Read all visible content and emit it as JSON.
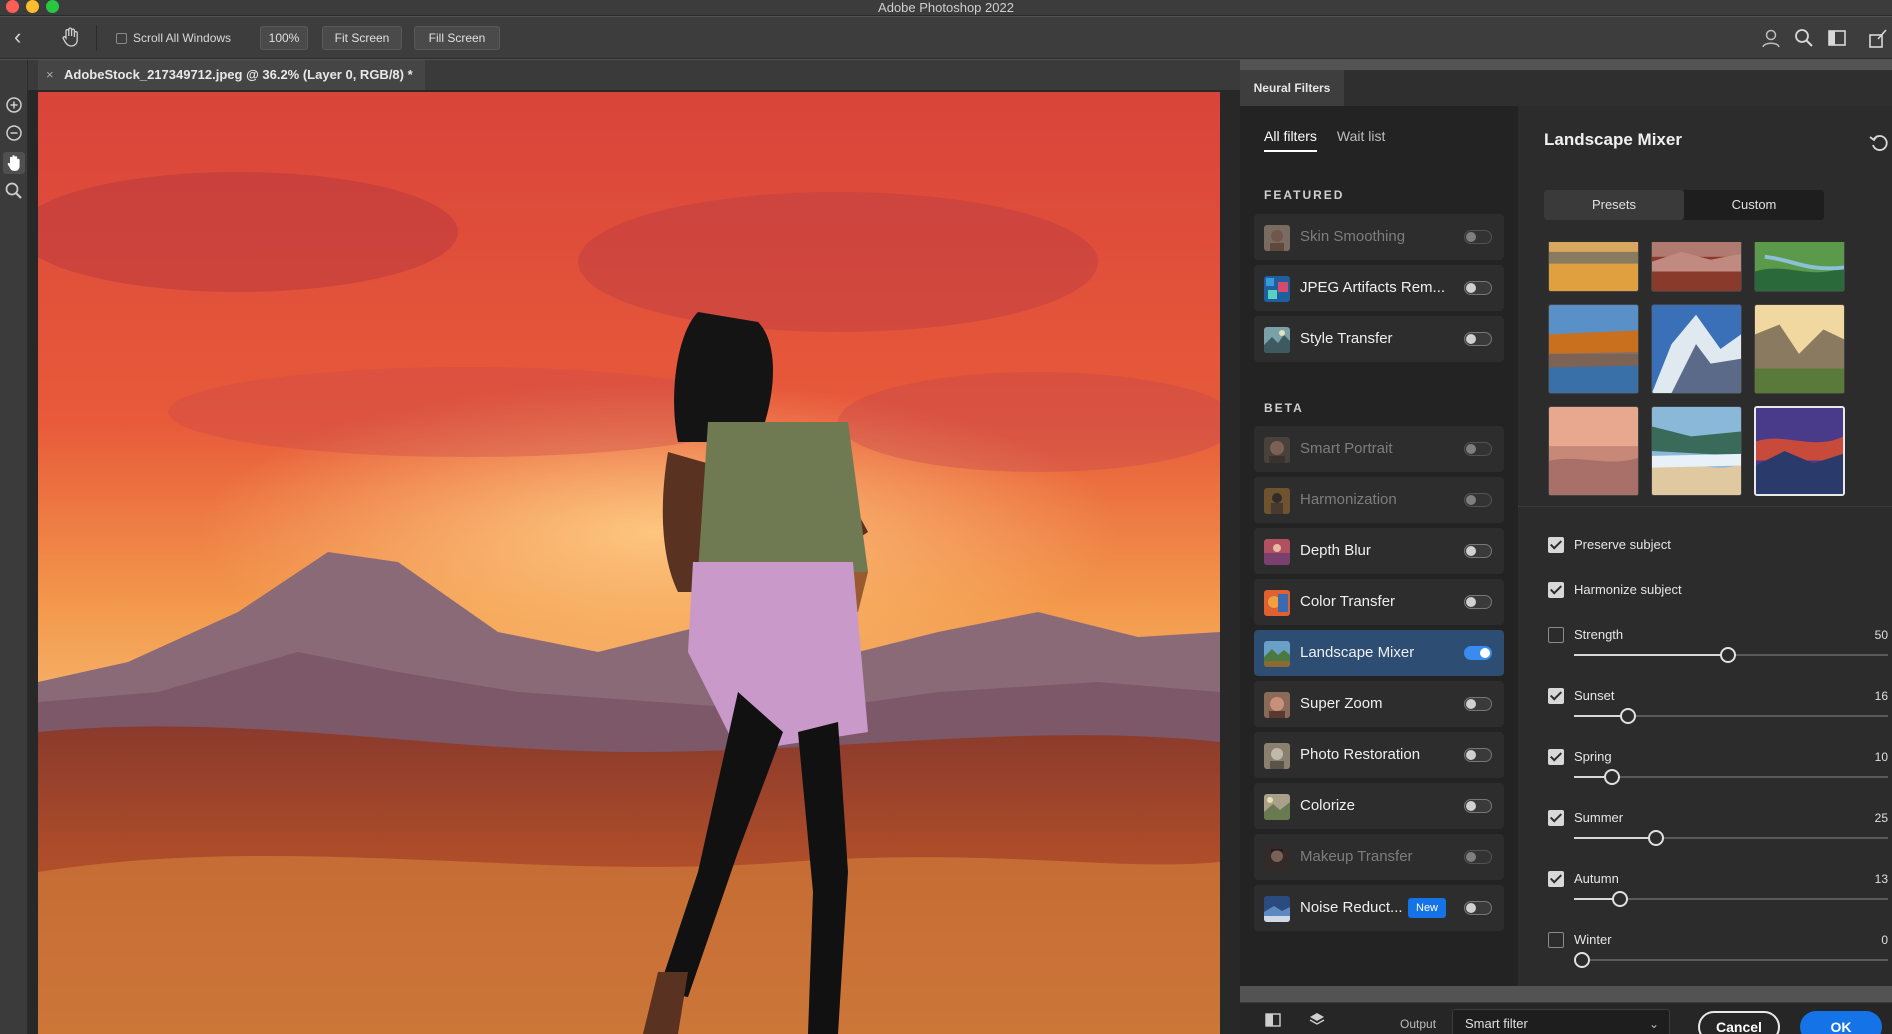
{
  "app": {
    "title": "Adobe Photoshop 2022"
  },
  "optionsbar": {
    "scroll_all_windows": "Scroll All Windows",
    "zoom_100": "100%",
    "fit_screen": "Fit Screen",
    "fill_screen": "Fill Screen"
  },
  "document": {
    "tab_title": "AdobeStock_217349712.jpeg @ 36.2% (Layer 0, RGB/8) *",
    "close_glyph": "×"
  },
  "panel": {
    "tab_label": "Neural Filters"
  },
  "filters": {
    "tabs": [
      "All filters",
      "Wait list"
    ],
    "featured_heading": "FEATURED",
    "beta_heading": "BETA",
    "featured": [
      {
        "label": "Skin Smoothing",
        "enabled": false,
        "dimmed": true
      },
      {
        "label": "JPEG Artifacts Rem...",
        "enabled": false,
        "dimmed": false
      },
      {
        "label": "Style Transfer",
        "enabled": false,
        "dimmed": false
      }
    ],
    "beta": [
      {
        "label": "Smart Portrait",
        "enabled": false,
        "dimmed": true
      },
      {
        "label": "Harmonization",
        "enabled": false,
        "dimmed": true
      },
      {
        "label": "Depth Blur",
        "enabled": false,
        "dimmed": false
      },
      {
        "label": "Color Transfer",
        "enabled": false,
        "dimmed": false
      },
      {
        "label": "Landscape Mixer",
        "enabled": true,
        "dimmed": false,
        "active": true
      },
      {
        "label": "Super Zoom",
        "enabled": false,
        "dimmed": false
      },
      {
        "label": "Photo Restoration",
        "enabled": false,
        "dimmed": false
      },
      {
        "label": "Colorize",
        "enabled": false,
        "dimmed": false
      },
      {
        "label": "Makeup Transfer",
        "enabled": false,
        "dimmed": true
      },
      {
        "label": "Noise Reduct...",
        "enabled": false,
        "dimmed": false,
        "badge": "New"
      }
    ]
  },
  "settings": {
    "title": "Landscape Mixer",
    "segments": [
      "Presets",
      "Custom"
    ],
    "selected_segment": "Presets",
    "preserve_subject": {
      "label": "Preserve subject",
      "checked": true
    },
    "harmonize_subject": {
      "label": "Harmonize subject",
      "checked": true
    },
    "sliders": [
      {
        "label": "Strength",
        "value": "50",
        "checked": false
      },
      {
        "label": "Sunset",
        "value": "16",
        "checked": true
      },
      {
        "label": "Spring",
        "value": "10",
        "checked": true
      },
      {
        "label": "Summer",
        "value": "25",
        "checked": true
      },
      {
        "label": "Autumn",
        "value": "13",
        "checked": true
      },
      {
        "label": "Winter",
        "value": "0",
        "checked": false
      }
    ]
  },
  "footer": {
    "output_label": "Output",
    "output_value": "Smart filter",
    "cancel": "Cancel",
    "ok": "OK"
  },
  "colors": {
    "accent": "#1473e6",
    "active_row": "#2d4d72",
    "panel_bg": "#232323"
  }
}
